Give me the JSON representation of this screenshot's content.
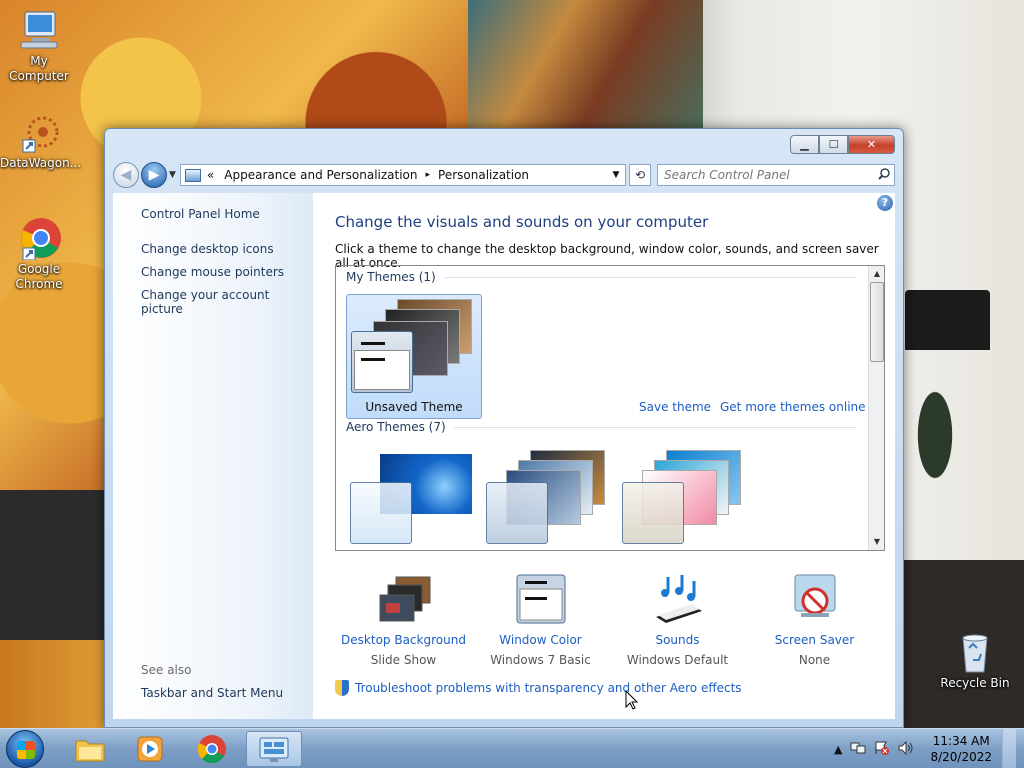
{
  "desktop": {
    "icons": [
      {
        "label": "My Computer",
        "icon": "computer-icon"
      },
      {
        "label": "DataWagon...",
        "icon": "datawagon-icon"
      },
      {
        "label": "Google Chrome",
        "icon": "chrome-icon"
      },
      {
        "label": "Recycle Bin",
        "icon": "recycle-bin-icon"
      }
    ]
  },
  "window": {
    "buttons": {
      "minimize": "▁",
      "maximize": "☐",
      "close": "✕"
    },
    "address": {
      "prefix": "«",
      "crumbs": [
        "Appearance and Personalization",
        "Personalization"
      ],
      "separator": "▸"
    },
    "search": {
      "placeholder": "Search Control Panel",
      "icon": "search-icon"
    },
    "help": "?"
  },
  "sidebar": {
    "home": "Control Panel Home",
    "links": [
      "Change desktop icons",
      "Change mouse pointers",
      "Change your account picture"
    ],
    "see_also": "See also",
    "see_also_links": [
      "Taskbar and Start Menu"
    ]
  },
  "main": {
    "heading": "Change the visuals and sounds on your computer",
    "subtitle": "Click a theme to change the desktop background, window color, sounds, and screen saver all at once.",
    "my_themes": {
      "title": "My Themes (1)",
      "items": [
        {
          "label": "Unsaved Theme",
          "selected": true
        }
      ],
      "save_link": "Save theme",
      "more_link": "Get more themes online"
    },
    "aero_themes": {
      "title": "Aero Themes (7)"
    },
    "settings": [
      {
        "label": "Desktop Background",
        "value": "Slide Show",
        "icon": "desktop-background-icon"
      },
      {
        "label": "Window Color",
        "value": "Windows 7 Basic",
        "icon": "window-color-icon"
      },
      {
        "label": "Sounds",
        "value": "Windows Default",
        "icon": "sounds-icon"
      },
      {
        "label": "Screen Saver",
        "value": "None",
        "icon": "screen-saver-icon"
      }
    ],
    "troubleshoot": "Troubleshoot problems with transparency and other Aero effects"
  },
  "taskbar": {
    "clock": {
      "time": "11:34 AM",
      "date": "8/20/2022"
    },
    "tray_arrow": "▲"
  }
}
